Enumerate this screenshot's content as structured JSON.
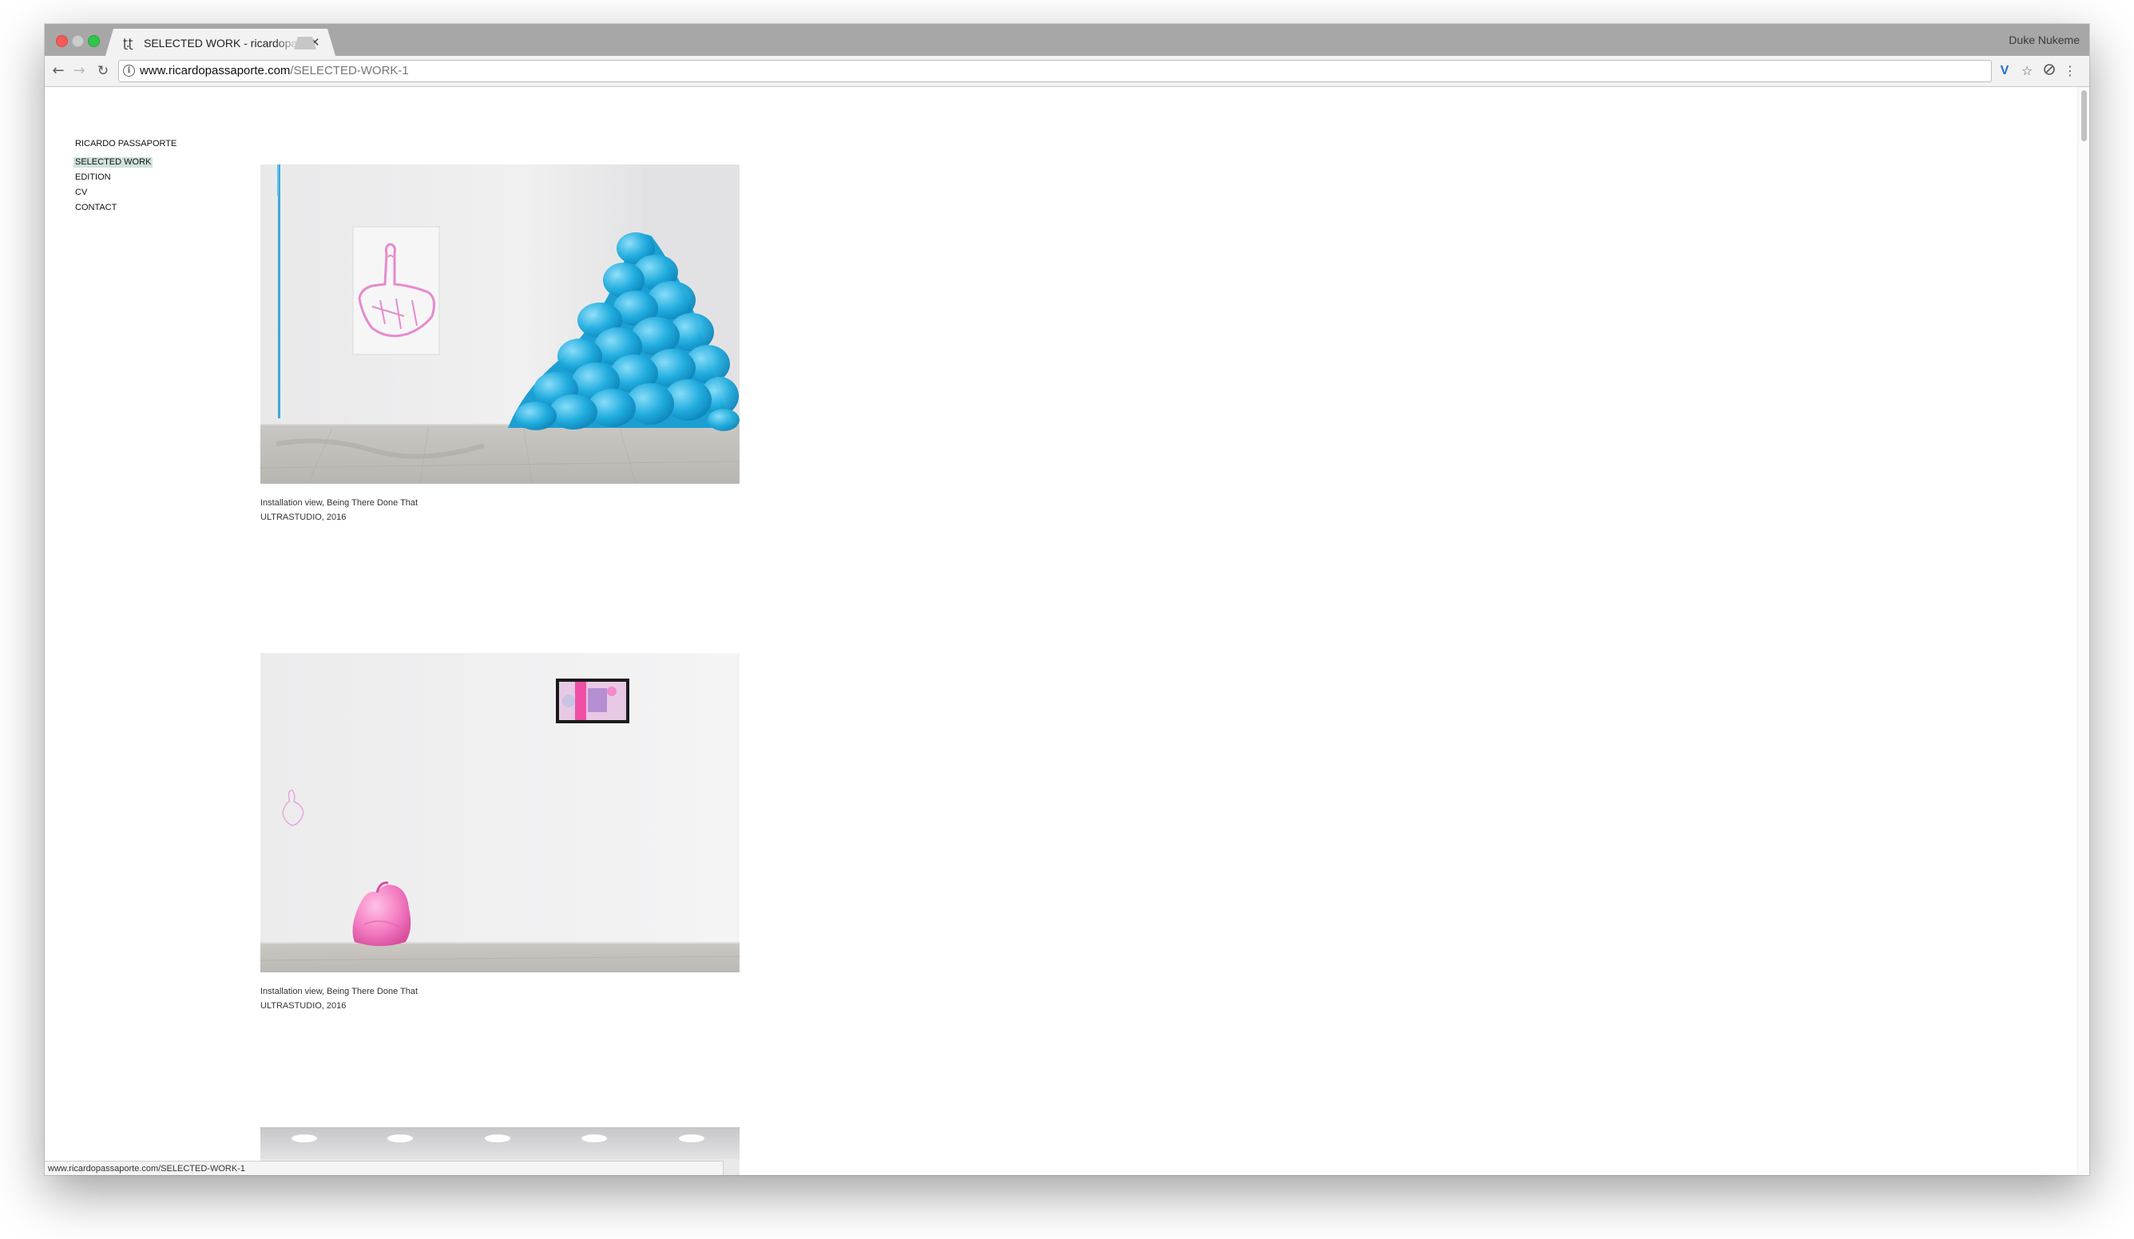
{
  "browser": {
    "tab_title": "SELECTED WORK - ricardopassaporte",
    "tab_favicon": "ʈ.ʈ",
    "profile_name": "Duke Nukeme",
    "url_host": "www.ricardopassaporte.com",
    "url_path": "/SELECTED-WORK-1",
    "status_url": "www.ricardopassaporte.com/SELECTED-WORK-1",
    "icons": {
      "back": "arrow-left-icon",
      "forward": "arrow-right-icon",
      "reload": "reload-icon",
      "info": "info-icon",
      "extension_v": "v-extension-icon",
      "bookmark": "star-icon",
      "shield": "shield-extension-icon",
      "menu": "kebab-menu-icon",
      "close_tab": "close-icon"
    }
  },
  "site": {
    "nav": [
      {
        "label": "RICARDO PASSAPORTE",
        "active": false
      },
      {
        "label": "SELECTED WORK",
        "active": true
      },
      {
        "label": "EDITION",
        "active": false
      },
      {
        "label": "CV",
        "active": false
      },
      {
        "label": "CONTACT",
        "active": false
      }
    ],
    "works": [
      {
        "caption_line1": "Installation view, Being There Done That",
        "caption_line2": "ULTRASTUDIO, 2016",
        "image": "installation-photo-blue-bags-and-hand-drawing"
      },
      {
        "caption_line1": "Installation view, Being There Done That",
        "caption_line2": "ULTRASTUDIO, 2016",
        "image": "installation-photo-pink-bag-and-screen"
      },
      {
        "image": "installation-photo-ceiling-lights"
      }
    ]
  },
  "colors": {
    "nav_active_highlight": "#cfe3db",
    "blue_bags": "#1aa7d9",
    "pink_bag": "#f07bbf",
    "drawing_pink": "#e48bd0"
  }
}
